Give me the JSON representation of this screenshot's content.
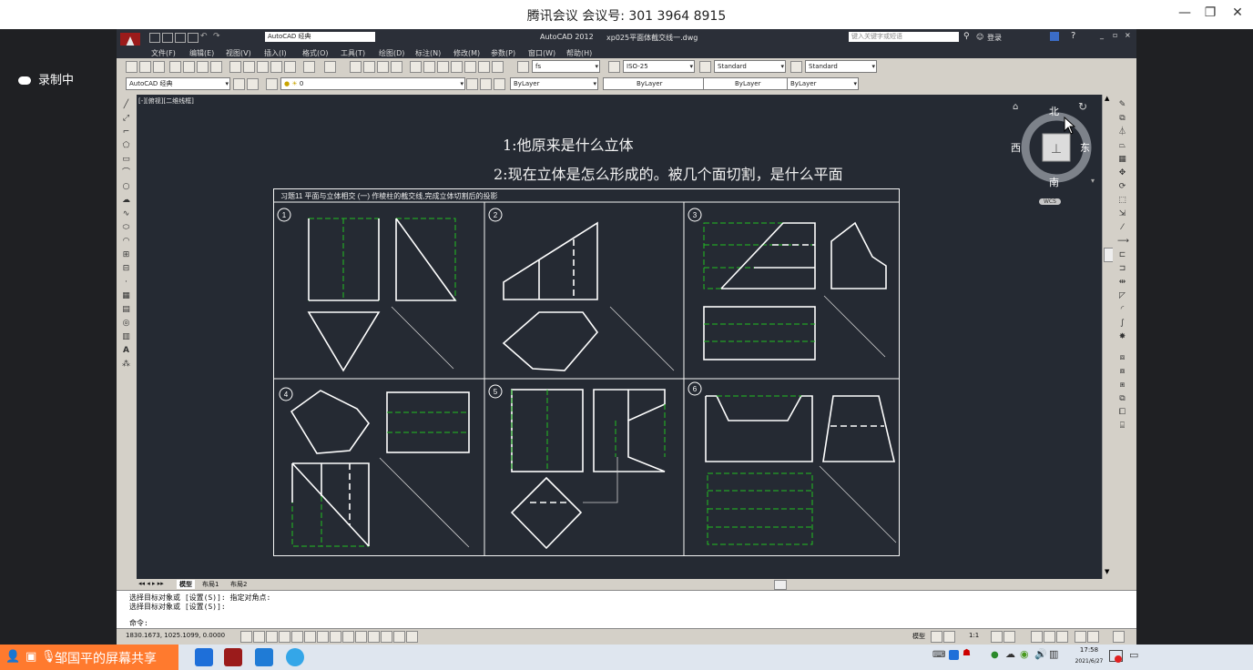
{
  "meeting": {
    "title": "腾讯会议 会议号: 301 3964 8915",
    "recording": "录制中",
    "share_label": "邹国平的屏幕共享"
  },
  "autocad": {
    "app_title": "AutoCAD 2012",
    "file_title": "xp025平面体截交线一.dwg",
    "workspace": "AutoCAD 经典",
    "search_placeholder": "键入关键字或短语",
    "login": "登录",
    "menus": [
      "文件(F)",
      "编辑(E)",
      "视图(V)",
      "插入(I)",
      "格式(O)",
      "工具(T)",
      "绘图(D)",
      "标注(N)",
      "修改(M)",
      "参数(P)",
      "窗口(W)",
      "帮助(H)"
    ],
    "text_style": "fs",
    "dim_style": "ISO-25",
    "table_style": "Standard",
    "multileader_style": "Standard",
    "layer": "0",
    "color": "ByLayer",
    "linetype": "ByLayer",
    "lineweight": "ByLayer",
    "plotstyle": "ByLayer",
    "viewport_label": "[-][俯视][二维线框]",
    "tabs": [
      "模型",
      "布局1",
      "布局2"
    ],
    "command_lines": [
      "选择目标对象或 [设置(S)]: 指定对角点:",
      "选择目标对象或 [设置(S)]:"
    ],
    "command_prompt": "命令:",
    "coords": "1830.1673, 1025.1099, 0.0000",
    "scale": "1:1",
    "model_label": "模型",
    "clock_time": "17:58",
    "clock_date": "2021/6/27"
  },
  "viewcube": {
    "north": "北",
    "south": "南",
    "east": "东",
    "west": "西",
    "wcs": "WCS"
  },
  "notes": {
    "q1": "1:他原来是什么立体",
    "q2": "2:现在立体是怎么形成的。被几个面切割，是什么平面"
  },
  "sheet": {
    "heading": "习题11 平面与立体相交 (一) 作棱柱的截交线,完成立体切割后的投影",
    "cells": [
      "1",
      "2",
      "3",
      "4",
      "5",
      "6"
    ]
  },
  "colors": {
    "canvas": "#252a33",
    "line": "#ffffff",
    "hidden": "#21c021",
    "accent": "#ff7a2e"
  }
}
